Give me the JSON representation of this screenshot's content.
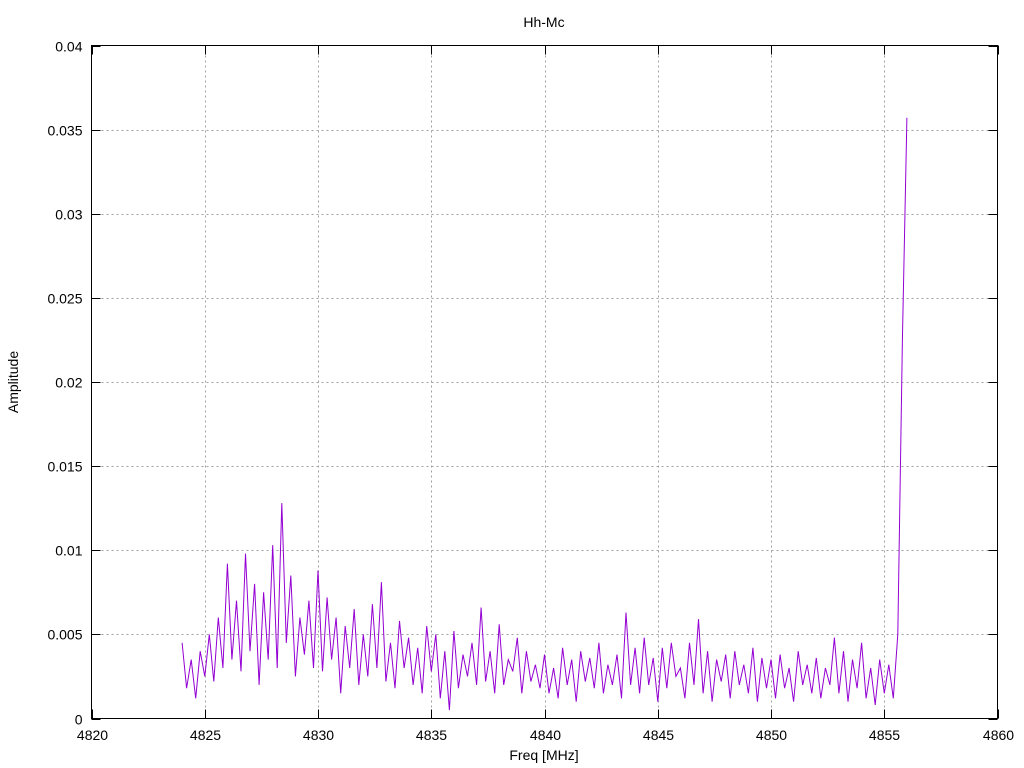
{
  "chart_data": {
    "type": "line",
    "title": "Hh-Mc",
    "xlabel": "Freq [MHz]",
    "ylabel": "Amplitude",
    "xlim": [
      4820,
      4860
    ],
    "ylim": [
      0,
      0.04
    ],
    "grid": true,
    "x_ticks": [
      "4820",
      "4825",
      "4830",
      "4835",
      "4840",
      "4845",
      "4850",
      "4855",
      "4860"
    ],
    "y_ticks": [
      "0",
      "0.005",
      "0.01",
      "0.015",
      "0.02",
      "0.025",
      "0.03",
      "0.035",
      "0.04"
    ],
    "series": [
      {
        "name": "Hh-Mc",
        "color": "#9400d3",
        "x_start": 4824.0,
        "x_step": 0.2,
        "values": [
          0.0045,
          0.0018,
          0.0035,
          0.0012,
          0.004,
          0.0025,
          0.005,
          0.0022,
          0.006,
          0.003,
          0.0092,
          0.0035,
          0.007,
          0.0028,
          0.0098,
          0.004,
          0.008,
          0.002,
          0.0075,
          0.0035,
          0.0103,
          0.003,
          0.0128,
          0.0045,
          0.0085,
          0.0025,
          0.006,
          0.0038,
          0.007,
          0.003,
          0.0088,
          0.0028,
          0.0072,
          0.0035,
          0.006,
          0.0015,
          0.0055,
          0.003,
          0.0065,
          0.002,
          0.005,
          0.0025,
          0.0068,
          0.003,
          0.0081,
          0.0022,
          0.0045,
          0.0018,
          0.0058,
          0.003,
          0.0048,
          0.002,
          0.0042,
          0.0015,
          0.0055,
          0.0028,
          0.005,
          0.0012,
          0.004,
          0.0005,
          0.0052,
          0.0018,
          0.0038,
          0.0025,
          0.0045,
          0.002,
          0.0066,
          0.0022,
          0.004,
          0.0015,
          0.0056,
          0.002,
          0.0035,
          0.0028,
          0.0048,
          0.0015,
          0.004,
          0.0022,
          0.0032,
          0.0018,
          0.0038,
          0.0015,
          0.003,
          0.0012,
          0.0042,
          0.002,
          0.0035,
          0.001,
          0.004,
          0.0022,
          0.0036,
          0.0018,
          0.0045,
          0.0015,
          0.0032,
          0.002,
          0.0038,
          0.0012,
          0.0063,
          0.002,
          0.0042,
          0.0015,
          0.0048,
          0.002,
          0.0036,
          0.001,
          0.0042,
          0.0018,
          0.0045,
          0.0025,
          0.003,
          0.0012,
          0.0045,
          0.002,
          0.0059,
          0.0015,
          0.004,
          0.001,
          0.0035,
          0.0022,
          0.0038,
          0.0012,
          0.004,
          0.002,
          0.0032,
          0.0015,
          0.0042,
          0.001,
          0.0036,
          0.0018,
          0.0035,
          0.0012,
          0.0038,
          0.0018,
          0.003,
          0.001,
          0.004,
          0.002,
          0.0032,
          0.0015,
          0.0036,
          0.0012,
          0.003,
          0.002,
          0.0048,
          0.0015,
          0.004,
          0.001,
          0.0035,
          0.0018,
          0.0045,
          0.0012,
          0.003,
          0.0008,
          0.0035,
          0.0015,
          0.0032,
          0.0012,
          0.005,
          0.0225,
          0.0357
        ]
      }
    ]
  }
}
